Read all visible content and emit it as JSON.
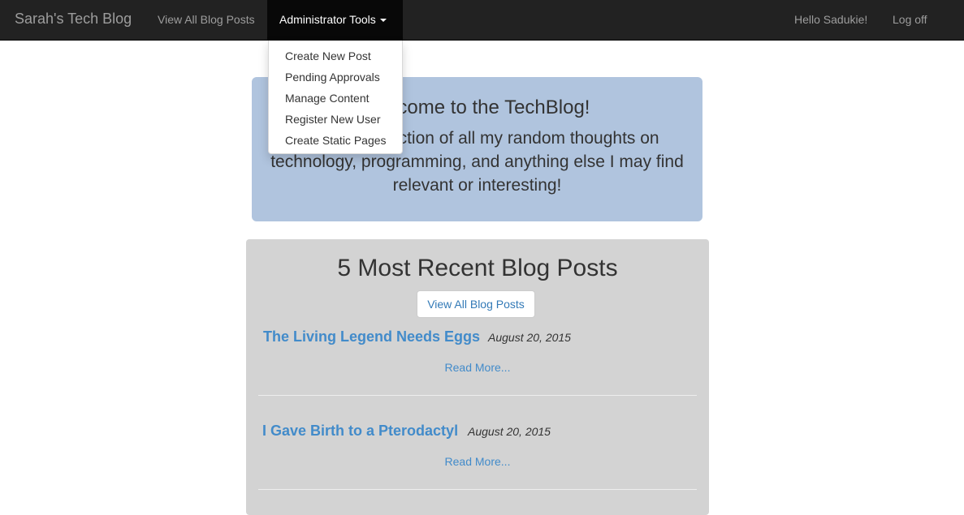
{
  "navbar": {
    "brand": "Sarah's Tech Blog",
    "view_all": "View All Blog Posts",
    "admin_tools": "Administrator Tools",
    "greeting": "Hello Sadukie!",
    "logoff": "Log off"
  },
  "admin_menu": {
    "items": [
      {
        "label": "Create New Post"
      },
      {
        "label": "Pending Approvals"
      },
      {
        "label": "Manage Content"
      },
      {
        "label": "Register New User"
      },
      {
        "label": "Create Static Pages"
      }
    ]
  },
  "jumbotron": {
    "title": "Welcome to the TechBlog!",
    "text": "This is a collection of all my random thoughts on technology, programming, and anything else I may find relevant or interesting!"
  },
  "recent": {
    "title": "5 Most Recent Blog Posts",
    "view_all_button": "View All Blog Posts",
    "posts": [
      {
        "title": "The Living Legend Needs Eggs",
        "date": "August 20, 2015",
        "read_more": "Read More..."
      },
      {
        "title": "I Gave Birth to a Pterodactyl",
        "date": "August 20, 2015",
        "read_more": "Read More..."
      }
    ]
  }
}
